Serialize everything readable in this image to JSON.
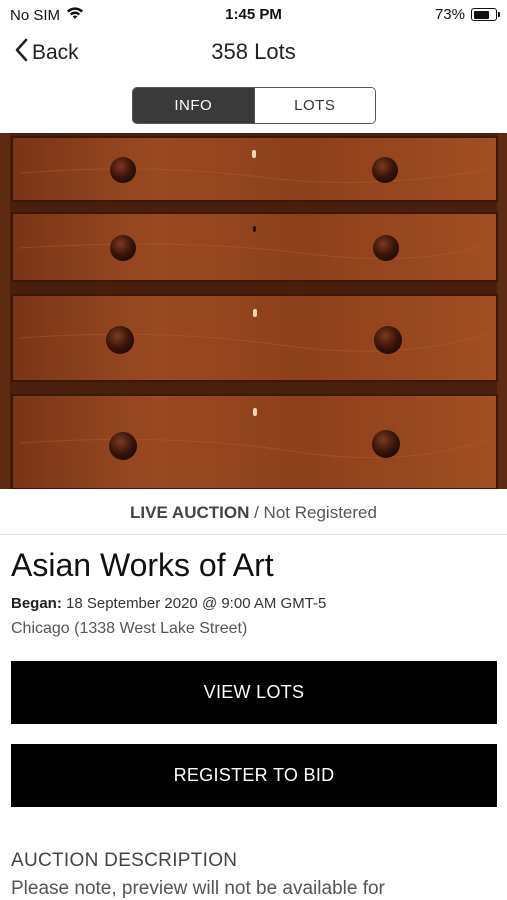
{
  "status_bar": {
    "carrier": "No SIM",
    "time": "1:45 PM",
    "battery_percent": "73%",
    "battery_level": 0.73
  },
  "nav": {
    "back_label": "Back",
    "title": "358 Lots"
  },
  "segments": {
    "info": "INFO",
    "lots": "LOTS",
    "selected": "INFO"
  },
  "auction": {
    "type": "LIVE AUCTION",
    "separator": " / ",
    "registration": "Not Registered",
    "title": "Asian Works of Art",
    "began_label": "Began:",
    "began_value": "18 September 2020 @ 9:00 AM GMT-5",
    "location": "Chicago (1338 West Lake Street)"
  },
  "buttons": {
    "view_lots": "VIEW LOTS",
    "register": "REGISTER TO BID"
  },
  "description": {
    "heading": "AUCTION DESCRIPTION",
    "text": "Please note, preview will not be available for"
  },
  "colors": {
    "wood": "#8a3f1a",
    "knob": "#3a1508",
    "button_bg": "#000000",
    "segment_active": "#3a3a3a"
  }
}
